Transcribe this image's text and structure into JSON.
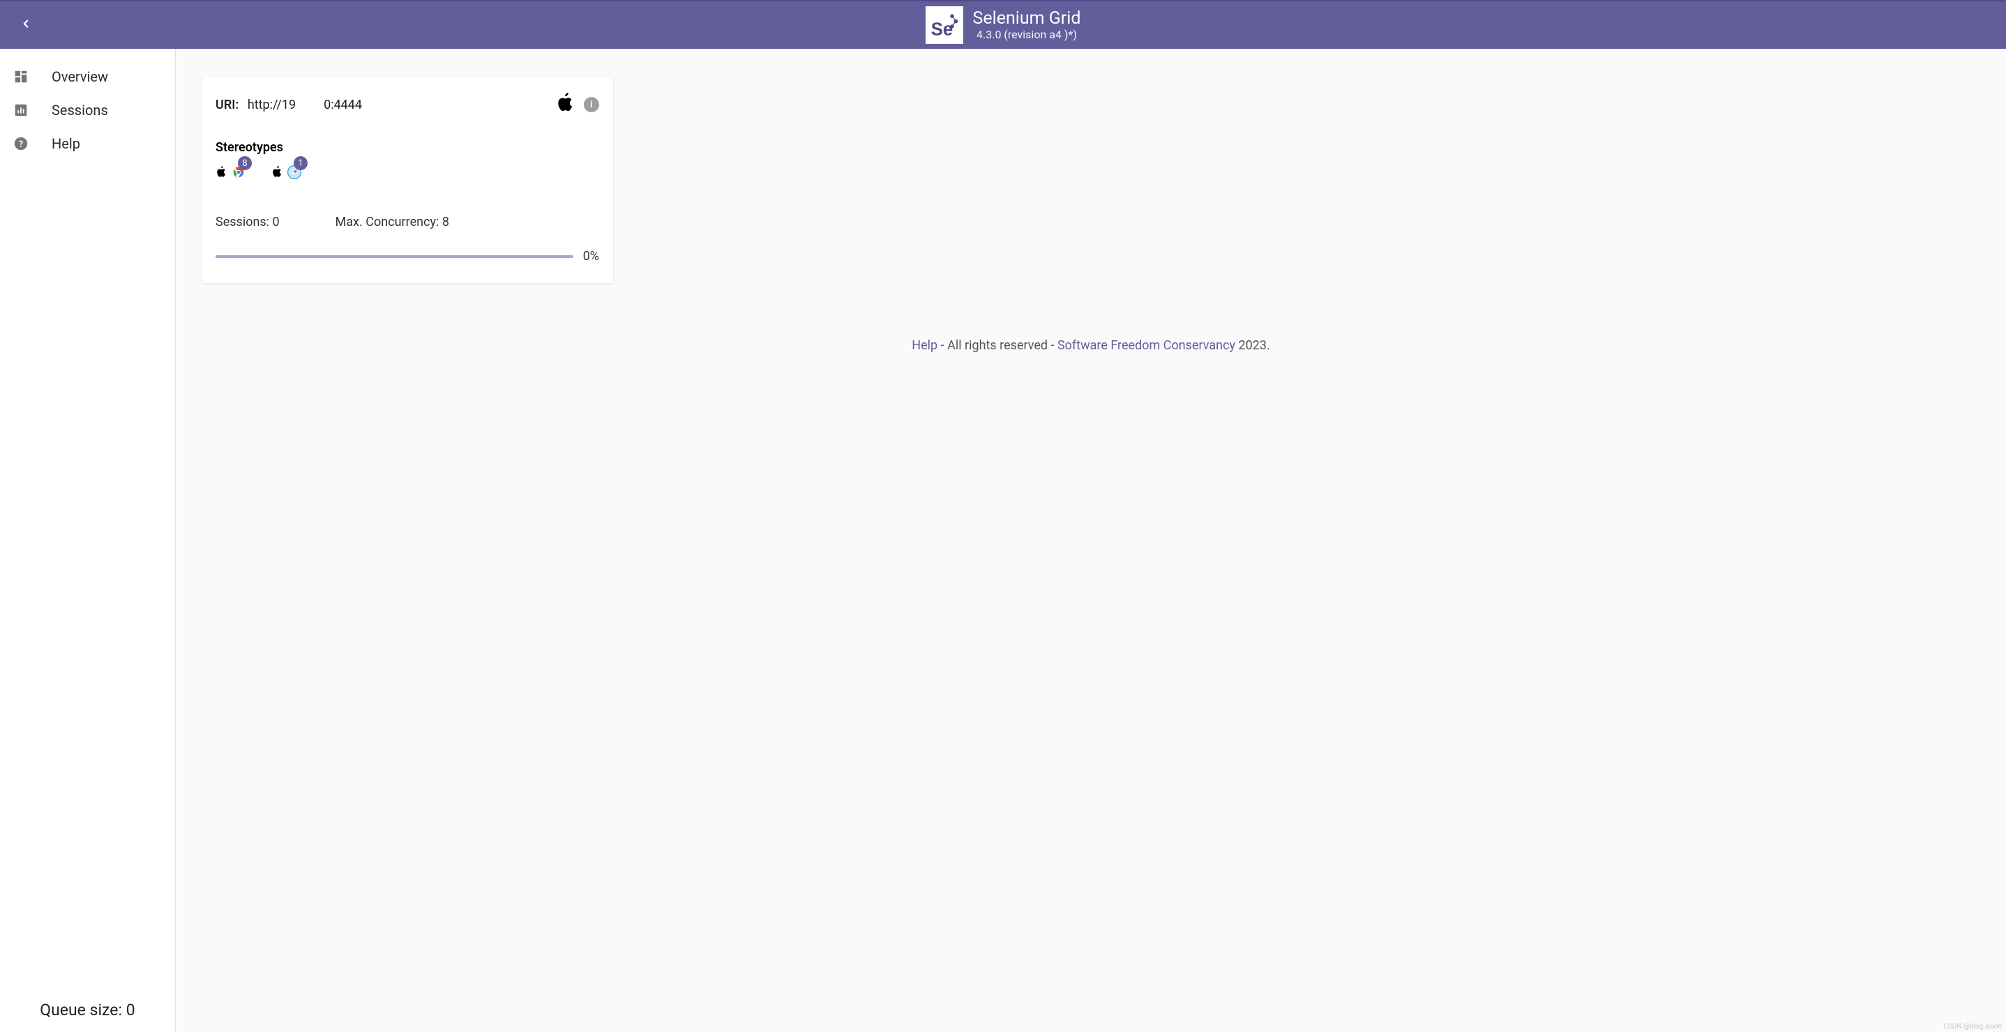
{
  "header": {
    "title": "Selenium Grid",
    "version": "4.3.0 (revision a4    )*)"
  },
  "sidebar": {
    "items": [
      {
        "label": "Overview"
      },
      {
        "label": "Sessions"
      },
      {
        "label": "Help"
      }
    ],
    "queue_label": "Queue size:",
    "queue_value": "0"
  },
  "node": {
    "uri_label": "URI:",
    "uri_prefix": "http://19",
    "uri_suffix": "0:4444",
    "stereotypes_label": "Stereotypes",
    "stereotypes": [
      {
        "platform": "mac",
        "browser": "chrome",
        "count": "8"
      },
      {
        "platform": "mac",
        "browser": "safari",
        "count": "1"
      }
    ],
    "sessions_label": "Sessions:",
    "sessions_value": "0",
    "concurrency_label": "Max. Concurrency:",
    "concurrency_value": "8",
    "progress_pct": "0%"
  },
  "footer": {
    "help": "Help",
    "reserved": " - All rights reserved - ",
    "sfc": "Software Freedom Conservancy",
    "year": " 2023."
  },
  "watermark": "CSDN @blog.xiaoh"
}
